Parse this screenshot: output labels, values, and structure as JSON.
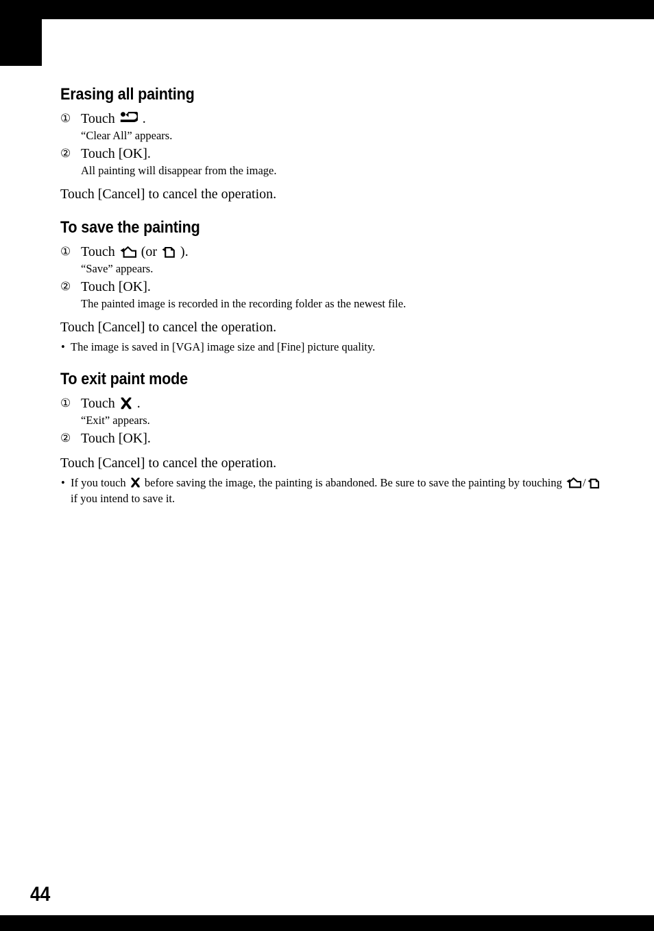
{
  "page": {
    "folio": "44",
    "icons": {
      "clear_all": "clear-all-undo-icon",
      "save_folder": "save-folder-icon",
      "save_document": "save-document-icon",
      "exit": "exit-close-icon"
    }
  },
  "sections": [
    {
      "heading": "Erasing all painting",
      "steps": [
        {
          "number": "①",
          "text_before": "Touch",
          "icon": "clear-all-undo-icon",
          "text_after": ".",
          "description": "“Clear All” appears."
        },
        {
          "number": "②",
          "text_before": "Touch [OK].",
          "icon": null,
          "text_after": "",
          "description": "All painting will disappear from the image."
        }
      ],
      "paragraph": "Touch [Cancel] to cancel the operation.",
      "bullets": []
    },
    {
      "heading": "To save the painting",
      "steps": [
        {
          "number": "①",
          "text_before": "Touch",
          "icon": "save-folder-icon",
          "middle": "(or",
          "icon2": "save-document-icon",
          "text_after": ").",
          "description": "“Save” appears."
        },
        {
          "number": "②",
          "text_before": "Touch [OK].",
          "icon": null,
          "text_after": "",
          "description": "The painted image is recorded in the recording folder as the newest file."
        }
      ],
      "paragraph": "Touch [Cancel] to cancel the operation.",
      "bullets": [
        {
          "marker": "•",
          "text": "The image is saved in [VGA] image size and [Fine] picture quality."
        }
      ]
    },
    {
      "heading": "To exit paint mode",
      "steps": [
        {
          "number": "①",
          "text_before": "Touch",
          "icon": "exit-close-icon",
          "text_after": ".",
          "description": "“Exit” appears."
        },
        {
          "number": "②",
          "text_before": "Touch [OK].",
          "icon": null,
          "text_after": "",
          "description": ""
        }
      ],
      "paragraph": "Touch [Cancel] to cancel the operation.",
      "bullets": [
        {
          "marker": "•",
          "part1": "If you touch",
          "icon": "exit-close-icon",
          "part2": "before saving the image, the painting is abandoned. Be sure to save the painting by touching",
          "icon2": "save-folder-icon",
          "separator": "/",
          "icon3": "save-document-icon",
          "part3": "if you intend to save it."
        }
      ]
    }
  ]
}
